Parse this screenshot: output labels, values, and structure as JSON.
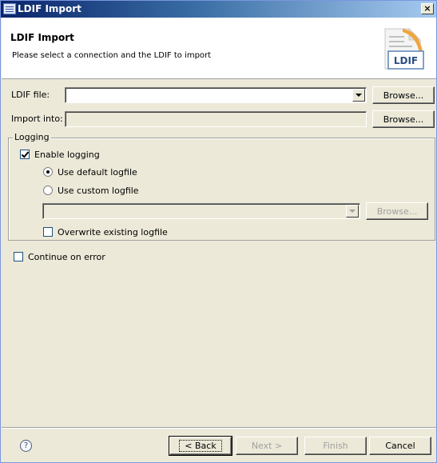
{
  "window": {
    "title": "LDIF Import",
    "close_glyph": "×"
  },
  "banner": {
    "title": "LDIF Import",
    "description": "Please select a connection and the LDIF to import",
    "icon_text": "LDIF"
  },
  "form": {
    "ldif_label": "LDIF file:",
    "ldif_value": "",
    "ldif_browse_label": "Browse...",
    "import_label": "Import into:",
    "import_value": "",
    "import_browse_label": "Browse..."
  },
  "logging": {
    "legend": "Logging",
    "enable_label": "Enable logging",
    "enable_checked": true,
    "default_logfile_label": "Use default logfile",
    "default_logfile_selected": true,
    "custom_logfile_label": "Use custom logfile",
    "custom_logfile_selected": false,
    "custom_path_value": "",
    "custom_browse_label": "Browse...",
    "overwrite_label": "Overwrite existing logfile",
    "overwrite_checked": false
  },
  "continue_on_error_label": "Continue on error",
  "continue_on_error_checked": false,
  "buttons": {
    "help_glyph": "?",
    "back_label": "< Back",
    "next_label": "Next >",
    "finish_label": "Finish",
    "cancel_label": "Cancel"
  },
  "icons": {
    "window": "ldif-window-icon",
    "banner": "ldif-document-icon",
    "help": "help-icon"
  }
}
